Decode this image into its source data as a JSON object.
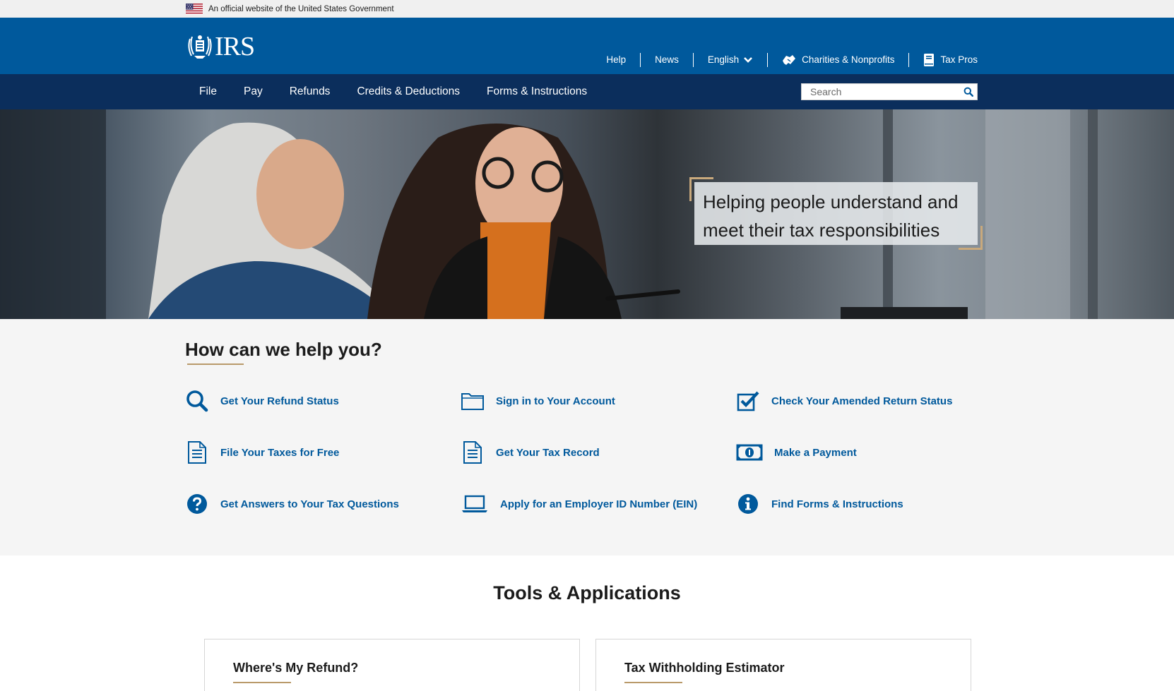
{
  "gov_banner": {
    "text": "An official website of the United States Government"
  },
  "header": {
    "logo_text": "IRS",
    "utility_nav": [
      {
        "label": "Help"
      },
      {
        "label": "News"
      },
      {
        "label": "English",
        "icon": "chevron-down-icon"
      },
      {
        "label": "Charities & Nonprofits",
        "icon": "handshake-icon"
      },
      {
        "label": "Tax Pros",
        "icon": "book-icon"
      }
    ]
  },
  "main_nav": {
    "items": [
      {
        "label": "File"
      },
      {
        "label": "Pay"
      },
      {
        "label": "Refunds"
      },
      {
        "label": "Credits & Deductions"
      },
      {
        "label": "Forms & Instructions"
      }
    ],
    "search_placeholder": "Search"
  },
  "hero": {
    "tagline": "Helping people understand and meet their tax responsibilities"
  },
  "help_section": {
    "title": "How can we help you?",
    "items": [
      {
        "label": "Get Your Refund Status",
        "icon": "search-icon"
      },
      {
        "label": "Sign in to Your Account",
        "icon": "folder-icon"
      },
      {
        "label": "Check Your Amended Return Status",
        "icon": "checkbox-icon"
      },
      {
        "label": "File Your Taxes for Free",
        "icon": "document-icon"
      },
      {
        "label": "Get Your Tax Record",
        "icon": "document-icon"
      },
      {
        "label": "Make a Payment",
        "icon": "money-icon"
      },
      {
        "label": "Get Answers to Your Tax Questions",
        "icon": "question-icon"
      },
      {
        "label": "Apply for an Employer ID Number (EIN)",
        "icon": "laptop-icon"
      },
      {
        "label": "Find Forms & Instructions",
        "icon": "info-icon"
      }
    ]
  },
  "tools_section": {
    "title": "Tools & Applications",
    "cards": [
      {
        "title": "Where's My Refund?"
      },
      {
        "title": "Tax Withholding Estimator"
      }
    ]
  },
  "colors": {
    "header_blue": "#00599c",
    "nav_navy": "#0b2e5c",
    "link_blue": "#00599c",
    "accent_gold": "#b99a6a"
  }
}
